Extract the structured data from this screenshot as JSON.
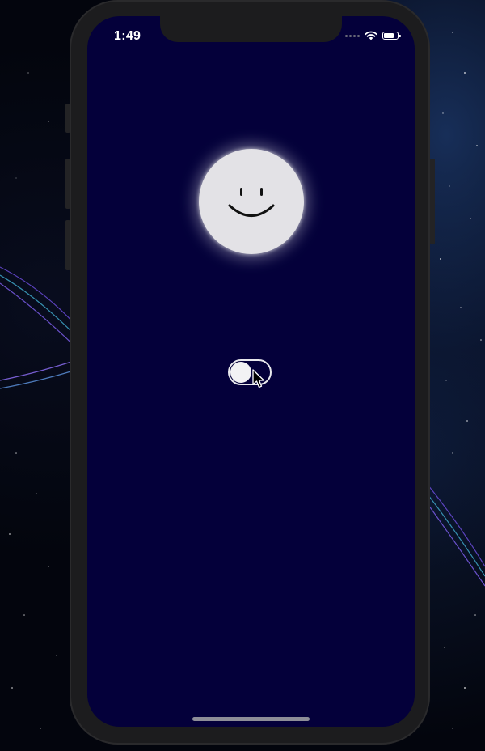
{
  "status_bar": {
    "time": "1:49",
    "wifi_icon": "wifi-icon",
    "battery_icon": "battery-icon",
    "battery_level": 0.8
  },
  "main": {
    "moon_icon": "smiley-face-icon",
    "toggle": {
      "state": "off",
      "icon": "toggle-switch"
    },
    "cursor_icon": "pointer-cursor-icon"
  },
  "colors": {
    "screen_background": "#04003a",
    "moon": "#e3e2e6",
    "toggle_border": "#e8e8ec"
  }
}
